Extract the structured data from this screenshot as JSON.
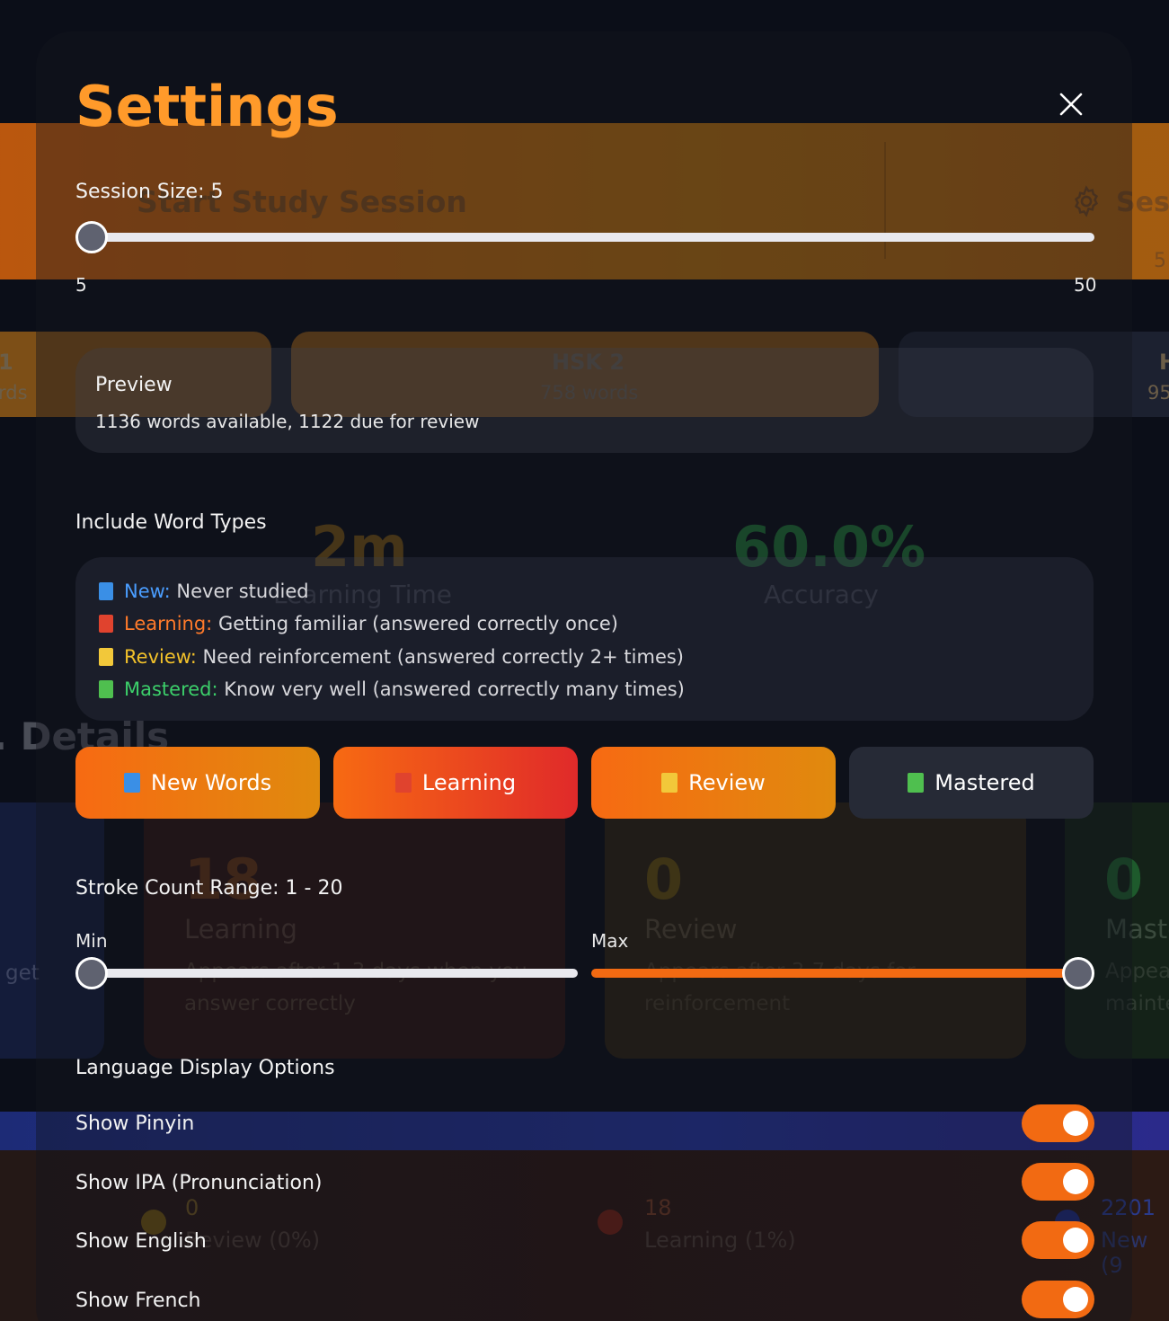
{
  "background": {
    "banner_title": "Start Study Session",
    "banner_session": "Sessi",
    "banner_session_num": "5",
    "hsk_levels": [
      {
        "name": "1",
        "sub": "rds"
      },
      {
        "name": "HSK 2",
        "sub": "758 words"
      },
      {
        "name": "H",
        "sub": "95"
      }
    ],
    "stats": [
      {
        "value": "2m",
        "label": "Learning Time"
      },
      {
        "value": "60.0%",
        "label": "Accuracy"
      }
    ],
    "details_heading": ". Details",
    "cards": [
      {
        "partial": "get"
      },
      {
        "value": "18",
        "label": "Learning",
        "desc1": "Appears after 1-3 days when you",
        "desc2": "answer correctly"
      },
      {
        "value": "0",
        "label": "Review",
        "desc1": "Appears after 3-7 days for",
        "desc2": "reinforcement"
      },
      {
        "value": "0",
        "label": "Maste",
        "desc1": "Appea",
        "desc2": "mainte"
      }
    ],
    "legend": [
      {
        "value": "0",
        "label": "Review (0%)",
        "color": "#b8860b"
      },
      {
        "value": "18",
        "label": "Learning (1%)",
        "color": "#c0391b"
      },
      {
        "value": "2201",
        "label": "New (9",
        "color": "#2a3db0"
      }
    ]
  },
  "modal": {
    "title": "Settings",
    "session_size": {
      "label": "Session Size: 5",
      "min_label": "5",
      "max_label": "50",
      "min": 5,
      "max": 50,
      "value": 5
    },
    "preview": {
      "title": "Preview",
      "text": "1136 words available, 1122 due for review"
    },
    "word_types": {
      "heading": "Include Word Types",
      "items": [
        {
          "name": "New:",
          "desc": "Never studied",
          "color": "#4a9dff",
          "square": "#3a8fe6"
        },
        {
          "name": "Learning:",
          "desc": "Getting familiar (answered correctly once)",
          "color": "#ff7a2a",
          "square": "#e0432e"
        },
        {
          "name": "Review:",
          "desc": "Need reinforcement (answered correctly 2+ times)",
          "color": "#f2c12a",
          "square": "#f2c83a"
        },
        {
          "name": "Mastered:",
          "desc": "Know very well (answered correctly many times)",
          "color": "#3ccf6a",
          "square": "#4fbf4f"
        }
      ],
      "buttons": [
        {
          "label": "New Words",
          "square": "#3a8fe6",
          "active": true
        },
        {
          "label": "Learning",
          "square": "#e0432e",
          "active": true
        },
        {
          "label": "Review",
          "square": "#f2c83a",
          "active": true
        },
        {
          "label": "Mastered",
          "square": "#4fbf4f",
          "active": false
        }
      ]
    },
    "stroke_range": {
      "label": "Stroke Count Range: 1 - 20",
      "min_label": "Min",
      "max_label": "Max",
      "min_value": 1,
      "max_value": 20
    },
    "language": {
      "heading": "Language Display Options",
      "options": [
        {
          "label": "Show Pinyin",
          "on": true
        },
        {
          "label": "Show IPA (Pronunciation)",
          "on": true
        },
        {
          "label": "Show English",
          "on": true
        },
        {
          "label": "Show French",
          "on": true
        }
      ]
    },
    "accent": "#f26a12",
    "title_color": "#ff9a2a"
  }
}
